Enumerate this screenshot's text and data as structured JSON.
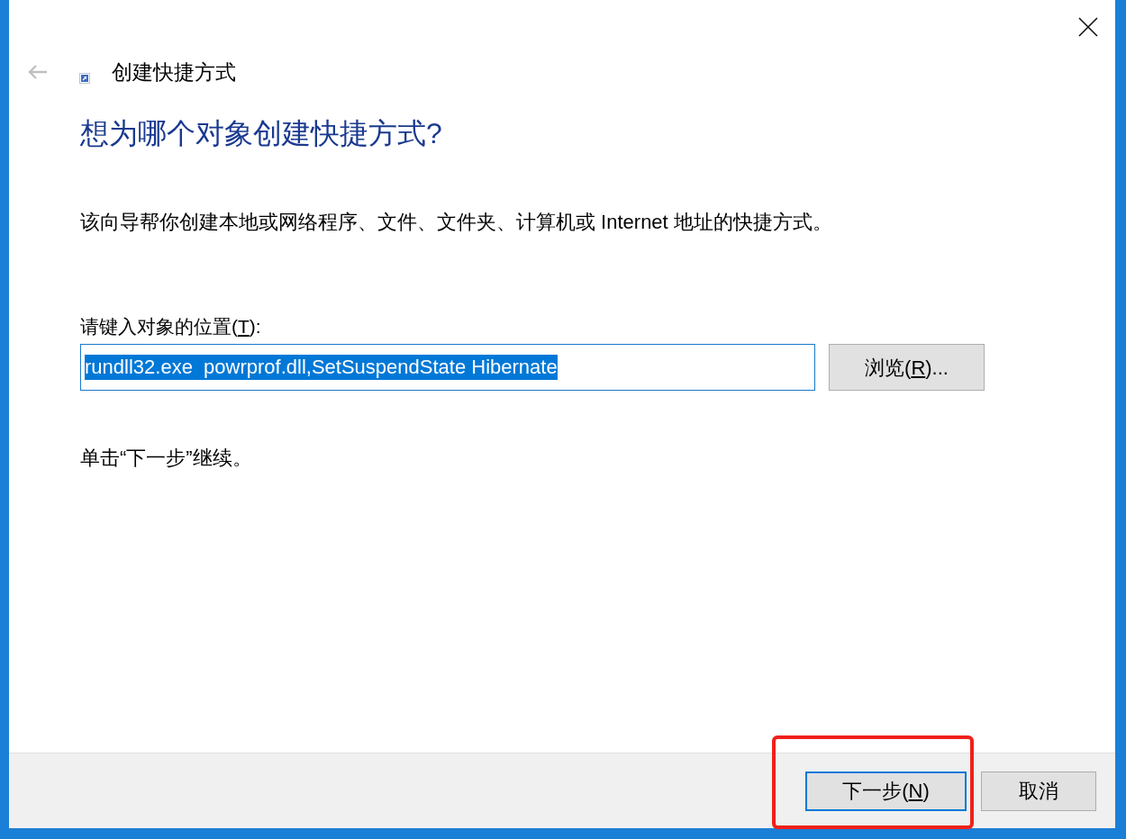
{
  "window": {
    "title": "创建快捷方式",
    "back_enabled": false
  },
  "heading": "想为哪个对象创建快捷方式?",
  "description": "该向导帮你创建本地或网络程序、文件、文件夹、计算机或 Internet 地址的快捷方式。",
  "location": {
    "label": {
      "before": "请键入对象的位置(",
      "access_key": "T",
      "after": "):"
    },
    "value": "rundll32.exe  powrprof.dll,SetSuspendState Hibernate",
    "value_selected": true,
    "browse_button": {
      "label": {
        "before": "浏览(",
        "access_key": "R",
        "after": ")..."
      }
    }
  },
  "hint": "单击“下一步”继续。",
  "buttons": [
    {
      "label": {
        "before": "下一步(",
        "access_key": "N",
        "after": ")"
      },
      "focused": true,
      "highlighted": true
    },
    {
      "label": {
        "before": "取消"
      },
      "focused": false,
      "highlighted": false
    }
  ]
}
